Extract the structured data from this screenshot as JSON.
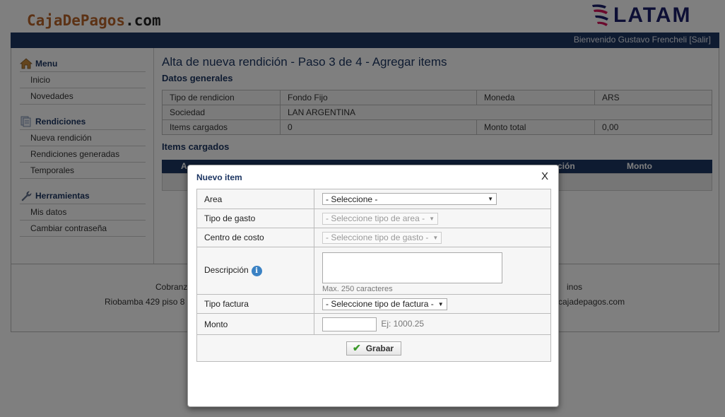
{
  "header": {
    "brand_name": "CajaDePagos",
    "brand_suffix": ".com",
    "latam_logo": "LATAM",
    "welcome": "Bienvenido Gustavo Frencheli [Salir]"
  },
  "sidebar": {
    "menu_title": "Menu",
    "menu_items": [
      "Inicio",
      "Novedades"
    ],
    "rendiciones_title": "Rendiciones",
    "rendiciones_items": [
      "Nueva rendición",
      "Rendiciones generadas",
      "Temporales"
    ],
    "herramientas_title": "Herramientas",
    "herramientas_items": [
      "Mis datos",
      "Cambiar contraseña"
    ]
  },
  "main": {
    "page_title": "Alta de nueva rendición - Paso 3 de 4 - Agregar items",
    "datos_generales_title": "Datos generales",
    "general_rows": [
      [
        "Tipo de rendicion",
        "Fondo Fijo",
        "Moneda",
        "ARS"
      ],
      [
        "Sociedad",
        "LAN ARGENTINA"
      ],
      [
        "Items cargados",
        "0",
        "Monto total",
        "0,00"
      ]
    ],
    "items_cargados_title": "Items cargados",
    "items_columns": [
      "A",
      "ción",
      "Monto"
    ]
  },
  "footer": {
    "line1_left": "Cobranz",
    "line1_right": "inos",
    "line2_left": "Riobamba 429 piso 8",
    "line2_right": "cajadepagos.com"
  },
  "modal": {
    "title": "Nuevo item",
    "close": "X",
    "area_label": "Area",
    "area_value": "- Seleccione -",
    "tipo_gasto_label": "Tipo de gasto",
    "tipo_gasto_value": "- Seleccione tipo de area -",
    "centro_costo_label": "Centro de costo",
    "centro_costo_value": "- Seleccione tipo de gasto -",
    "descripcion_label": "Descripción",
    "descripcion_hint": "Max. 250 caracteres",
    "tipo_factura_label": "Tipo factura",
    "tipo_factura_value": "- Seleccione tipo de factura -",
    "monto_label": "Monto",
    "monto_hint": "Ej: 1000.25",
    "save_label": "Grabar"
  },
  "colors": {
    "navy": "#1d3663",
    "brand_orange": "#b8652a",
    "latam_indigo": "#1b1f6b",
    "latam_magenta": "#d4145a"
  }
}
